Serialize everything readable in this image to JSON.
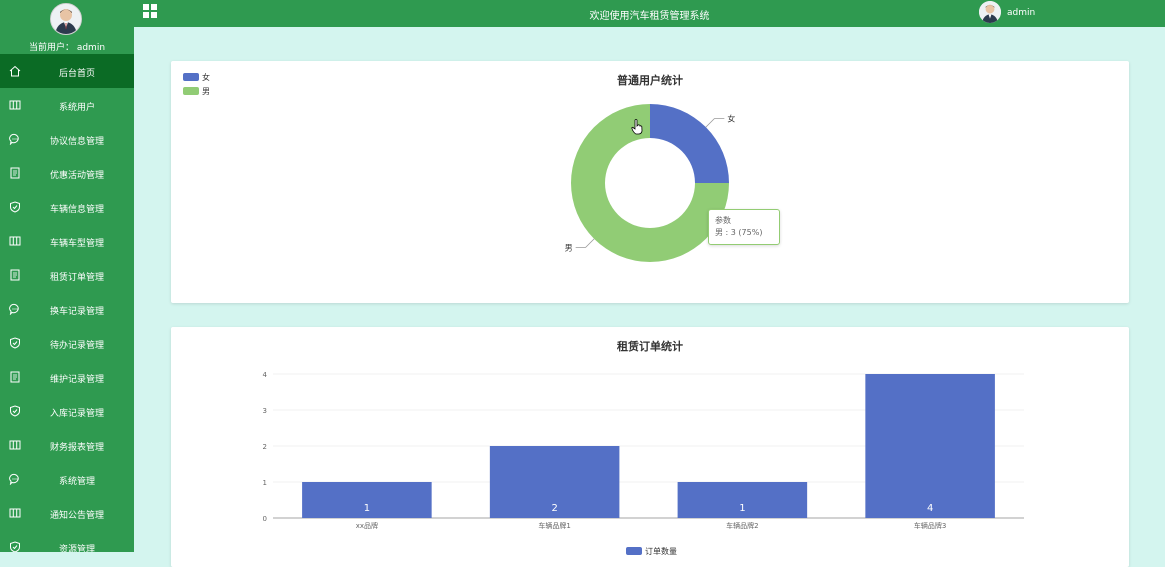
{
  "sidebar": {
    "user_label": "当前用户： admin",
    "items": [
      {
        "label": "后台首页",
        "icon": "home-icon",
        "active": true
      },
      {
        "label": "系统用户",
        "icon": "columns-icon"
      },
      {
        "label": "协议信息管理",
        "icon": "chat-icon"
      },
      {
        "label": "优惠活动管理",
        "icon": "document-icon"
      },
      {
        "label": "车辆信息管理",
        "icon": "shield-icon"
      },
      {
        "label": "车辆车型管理",
        "icon": "columns-icon"
      },
      {
        "label": "租赁订单管理",
        "icon": "document-icon"
      },
      {
        "label": "换车记录管理",
        "icon": "chat-icon"
      },
      {
        "label": "待办记录管理",
        "icon": "shield-icon"
      },
      {
        "label": "维护记录管理",
        "icon": "document-icon"
      },
      {
        "label": "入库记录管理",
        "icon": "shield-icon"
      },
      {
        "label": "财务报表管理",
        "icon": "columns-icon"
      },
      {
        "label": "系统管理",
        "icon": "chat-icon"
      },
      {
        "label": "通知公告管理",
        "icon": "columns-icon"
      },
      {
        "label": "资源管理",
        "icon": "shield-icon"
      }
    ]
  },
  "header": {
    "title": "欢迎使用汽车租赁管理系统",
    "user": "admin"
  },
  "colors": {
    "primary": "#2f9a50",
    "active": "#0b6b25",
    "background": "#d4f5ef",
    "series_blue": "#5470c6",
    "series_green": "#91cc75"
  },
  "pie_card": {
    "tooltip": {
      "title": "参数",
      "body": "男 : 3 (75%)"
    }
  },
  "chart_data": [
    {
      "type": "pie",
      "title": "普通用户统计",
      "legend_position": "top-left",
      "slices": [
        {
          "label": "女",
          "value": 1,
          "color": "#5470c6"
        },
        {
          "label": "男",
          "value": 3,
          "color": "#91cc75"
        }
      ]
    },
    {
      "type": "bar",
      "title": "租赁订单统计",
      "categories": [
        "xx品牌",
        "车辆品牌1",
        "车辆品牌2",
        "车辆品牌3"
      ],
      "values": [
        1,
        2,
        1,
        4
      ],
      "series": [
        {
          "name": "订单数量",
          "values": [
            1,
            2,
            1,
            4
          ],
          "color": "#5470c6"
        }
      ],
      "ylim": [
        0,
        4
      ],
      "yticks": [
        0,
        1,
        2,
        3,
        4
      ],
      "grid": true,
      "legend_position": "bottom"
    }
  ]
}
